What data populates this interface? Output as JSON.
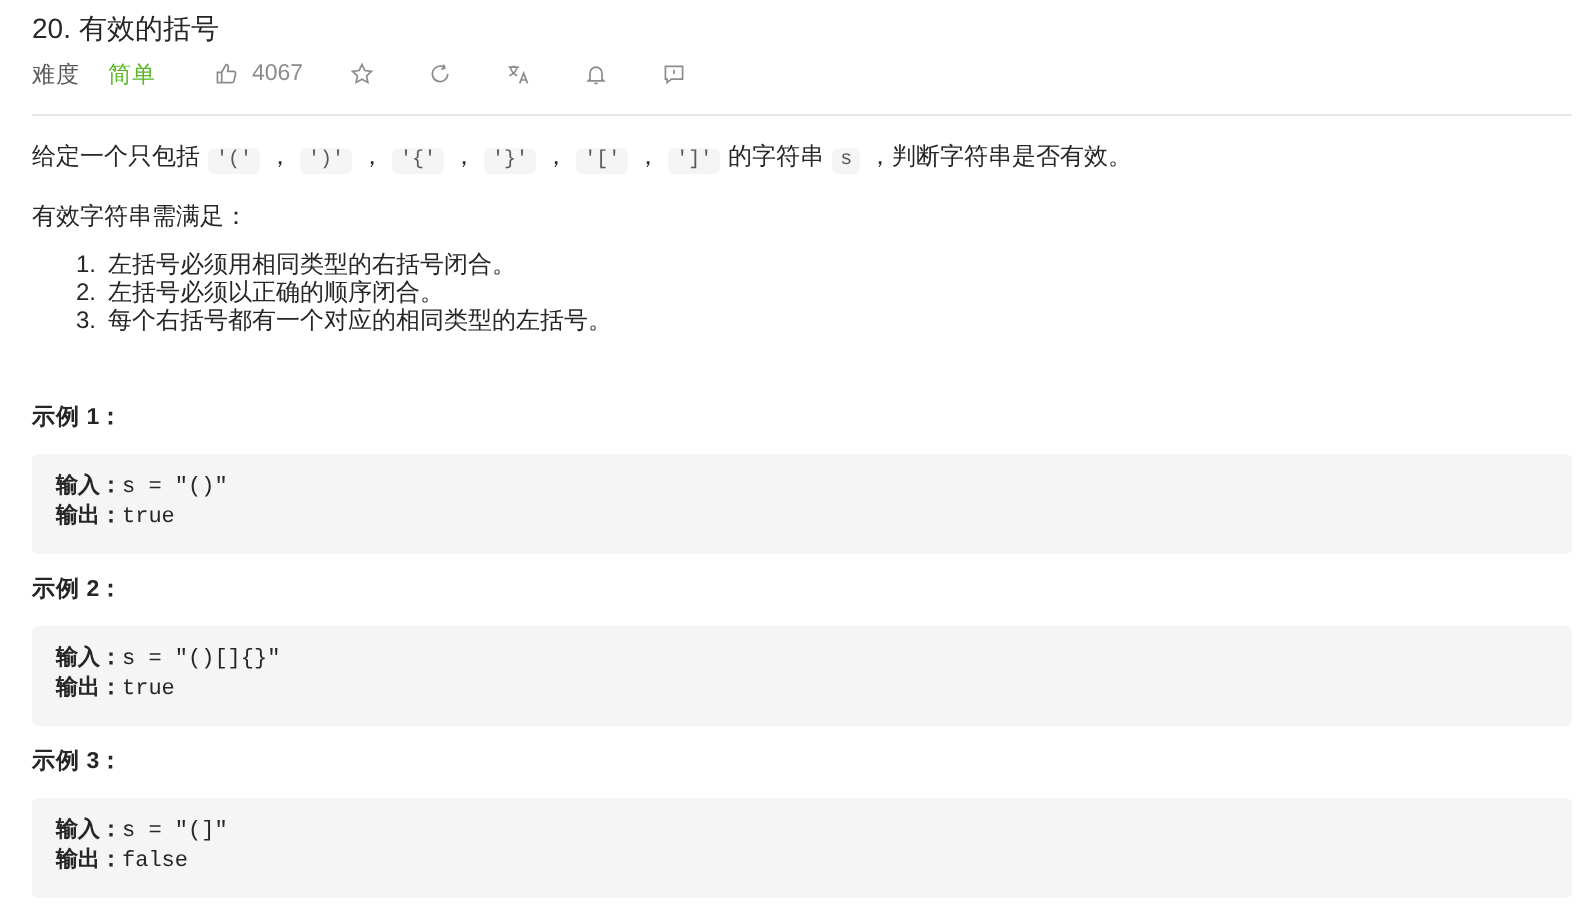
{
  "title": "20. 有效的括号",
  "meta": {
    "difficulty_label": "难度",
    "difficulty": "简单",
    "likes": "4067"
  },
  "intro": [
    {
      "kind": "text",
      "text": "给定一个只包括"
    },
    {
      "kind": "code",
      "text": "'('"
    },
    {
      "kind": "text",
      "text": "，"
    },
    {
      "kind": "code",
      "text": "')'"
    },
    {
      "kind": "text",
      "text": "，"
    },
    {
      "kind": "code",
      "text": "'{'"
    },
    {
      "kind": "text",
      "text": "，"
    },
    {
      "kind": "code",
      "text": "'}'"
    },
    {
      "kind": "text",
      "text": "，"
    },
    {
      "kind": "code",
      "text": "'['"
    },
    {
      "kind": "text",
      "text": "，"
    },
    {
      "kind": "code",
      "text": "']'"
    },
    {
      "kind": "text",
      "text": "的字符串"
    },
    {
      "kind": "code",
      "text": "s"
    },
    {
      "kind": "text",
      "text": "，判断字符串是否有效。"
    }
  ],
  "rules_heading": "有效字符串需满足：",
  "rules": [
    {
      "number": "1.",
      "text": "左括号必须用相同类型的右括号闭合。"
    },
    {
      "number": "2.",
      "text": "左括号必须以正确的顺序闭合。"
    },
    {
      "number": "3.",
      "text": "每个右括号都有一个对应的相同类型的左括号。"
    }
  ],
  "examples": [
    {
      "heading": "示例 1：",
      "lines": [
        "**输入：**s = \"()\"",
        "**输出：**true"
      ]
    },
    {
      "heading": "示例 2：",
      "lines": [
        "**输入：**s = \"()[]{}\"",
        "**输出：**true"
      ]
    },
    {
      "heading": "示例 3：",
      "lines": [
        "**输入：**s = \"(]\"",
        "**输出：**false"
      ]
    }
  ]
}
